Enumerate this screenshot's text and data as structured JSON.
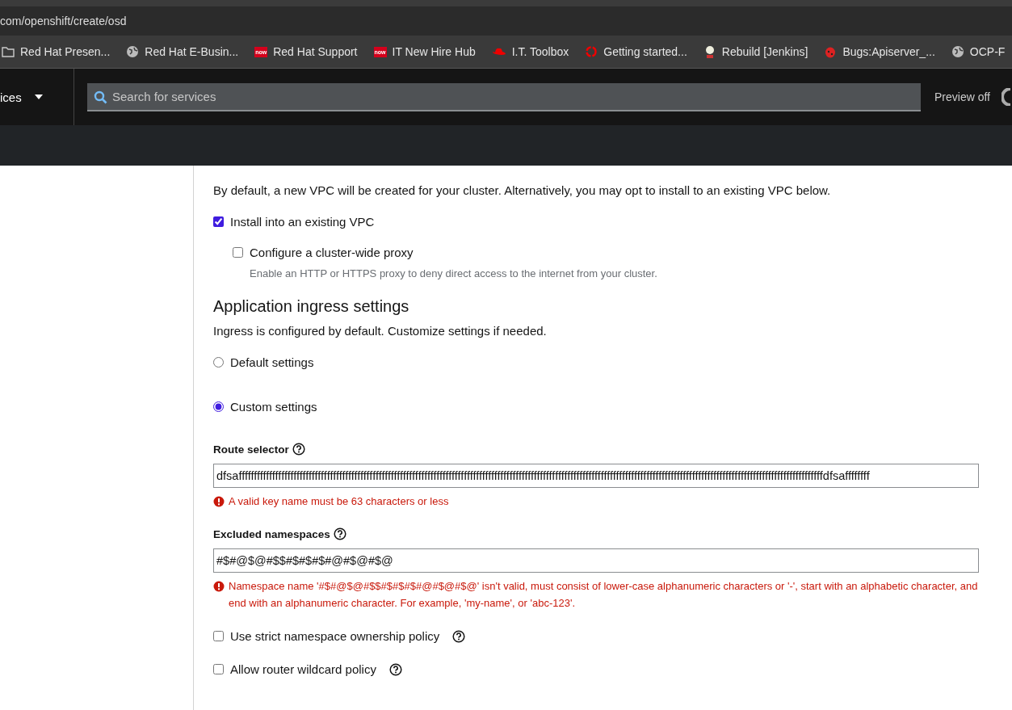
{
  "browser": {
    "url": "com/openshift/create/osd",
    "bookmarks": [
      {
        "kind": "folder",
        "label": "Red Hat Presen..."
      },
      {
        "kind": "globe",
        "label": "Red Hat E-Busin..."
      },
      {
        "kind": "now",
        "logo_text": "now",
        "label": "Red Hat Support"
      },
      {
        "kind": "now",
        "logo_text": "now",
        "label": "IT New Hire Hub"
      },
      {
        "kind": "hat",
        "label": "I.T. Toolbox"
      },
      {
        "kind": "ring",
        "label": "Getting started..."
      },
      {
        "kind": "person",
        "label": "Rebuild [Jenkins]"
      },
      {
        "kind": "bug",
        "label": "Bugs:Apiserver_..."
      },
      {
        "kind": "globe",
        "label": "OCP-F"
      }
    ]
  },
  "header": {
    "menu_label": "ices",
    "search": {
      "placeholder": "Search for services"
    },
    "preview": "Preview off"
  },
  "vpc": {
    "description": "By default, a new VPC will be created for your cluster. Alternatively, you may opt to install to an existing VPC below.",
    "install_existing": {
      "label": "Install into an existing VPC",
      "checked": true
    },
    "proxy": {
      "label": "Configure a cluster-wide proxy",
      "checked": false,
      "help": "Enable an HTTP or HTTPS proxy to deny direct access to the internet from your cluster."
    }
  },
  "ingress": {
    "title": "Application ingress settings",
    "description": "Ingress is configured by default. Customize settings if needed.",
    "options": [
      {
        "label": "Default settings",
        "selected": false
      },
      {
        "label": "Custom settings",
        "selected": true
      }
    ],
    "route_selector": {
      "label": "Route selector",
      "value": "dfsaffffffffffffffffffffffffffffffffffffffffffffffffffffffffffffffffffffffffffffffffffffffffffffffffffffffffffffffffffffffffffffffffffffffffffffffffffffffffffffffffffffffffffffffffffffffffffffffffdfsaffffffff",
      "error": "A valid key name must be 63 characters or less"
    },
    "excluded_namespaces": {
      "label": "Excluded namespaces",
      "value": "#$#@$@#$$#$#$#$#@#$@#$@",
      "error": "Namespace name '#$#@$@#$$#$#$#$#@#$@#$@' isn't valid, must consist of lower-case alphanumeric characters or '-', start with an alphabetic character, and end with an alphanumeric character. For example, 'my-name', or 'abc-123'."
    },
    "policies": [
      {
        "label": "Use strict namespace ownership policy",
        "checked": false
      },
      {
        "label": "Allow router wildcard policy",
        "checked": false
      }
    ]
  }
}
